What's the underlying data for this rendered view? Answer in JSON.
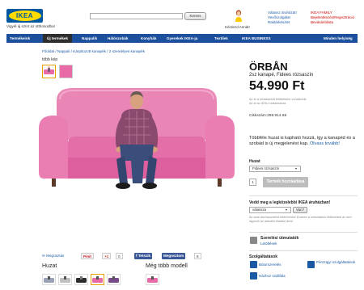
{
  "header": {
    "logo": "IKEA",
    "tagline": "Vigyél új színt az otthonodba!",
    "search_placeholder": "",
    "search_button": "Keress",
    "greeting": "Kérdezd Annát!",
    "links_blue": [
      "Válassz áruházat!",
      "Vevőszolgálat",
      "Raktárkészlet"
    ],
    "links_red": [
      "IKEA FAMILY",
      "Bejelentkezés/Regisztráció",
      "Bevásárlólista"
    ]
  },
  "nav": {
    "items": [
      "Termékeink",
      "Új termékek",
      "Nappalik",
      "Hálószobák",
      "Konyhák",
      "Gyerekek IKEA-ja",
      "Textilek",
      "IKEA BUSINESS",
      "Minden helyiség"
    ],
    "active_index": 1
  },
  "breadcrumb": "Főoldal / Nappali / Kárpitozott kanapék / 2 személyes kanapék",
  "gallery": {
    "more_images_label": "több kép"
  },
  "product": {
    "name": "ÖRBÅN",
    "subtitle": "2sz kanapé, Fidees rózsaszín",
    "price": "54.990 Ft",
    "fine1": "Az ár a kiválasztott feltételekre vonatkozik",
    "fine2": "Az ár az ÁFA-t tartalmazza.",
    "article_no": "Cikkszám:298.914.68",
    "description": "Többféle huzat is kapható hozzá, így a kanapéd és a szobád is új megjelenést kap.",
    "read_more": "Olvass tovább!",
    "cover_label": "Huzat",
    "cover_value": "Fidees rózsaszín",
    "quantity": "1",
    "buy_button": "Termék hozzáadása"
  },
  "store": {
    "heading": "Vedd meg a legközelebbi IKEA áruházban!",
    "select_value": "válassza",
    "check_button": "Van?",
    "note": "Az árak áruházanként eltérhetnek! Ezekért a weboldalon feltüntetett ár nem egyezik az aktuális eladási árral."
  },
  "assembly": {
    "label": "Szerelési útmutatók",
    "link": "Letöltések"
  },
  "services": {
    "heading": "Szolgáltatások",
    "items": [
      "Bútorszerelés",
      "Pénzügyi szolgáltatások",
      "Házhoz szállítás"
    ]
  },
  "share": {
    "email": "Megosztás",
    "pinterest": "Pinit",
    "gplus": "+1",
    "gplus_count": "0",
    "fb_like": "Tetszik",
    "fb_share": "Megosztom",
    "fb_count": "6"
  },
  "sections": {
    "covers": "Huzat",
    "more_models": "Még több modell"
  },
  "colors": {
    "brand_blue": "#0058a3",
    "brand_yellow": "#ffdb00",
    "nav_blue": "#1c4f9c",
    "sofa_pink": "#e86aa6"
  }
}
